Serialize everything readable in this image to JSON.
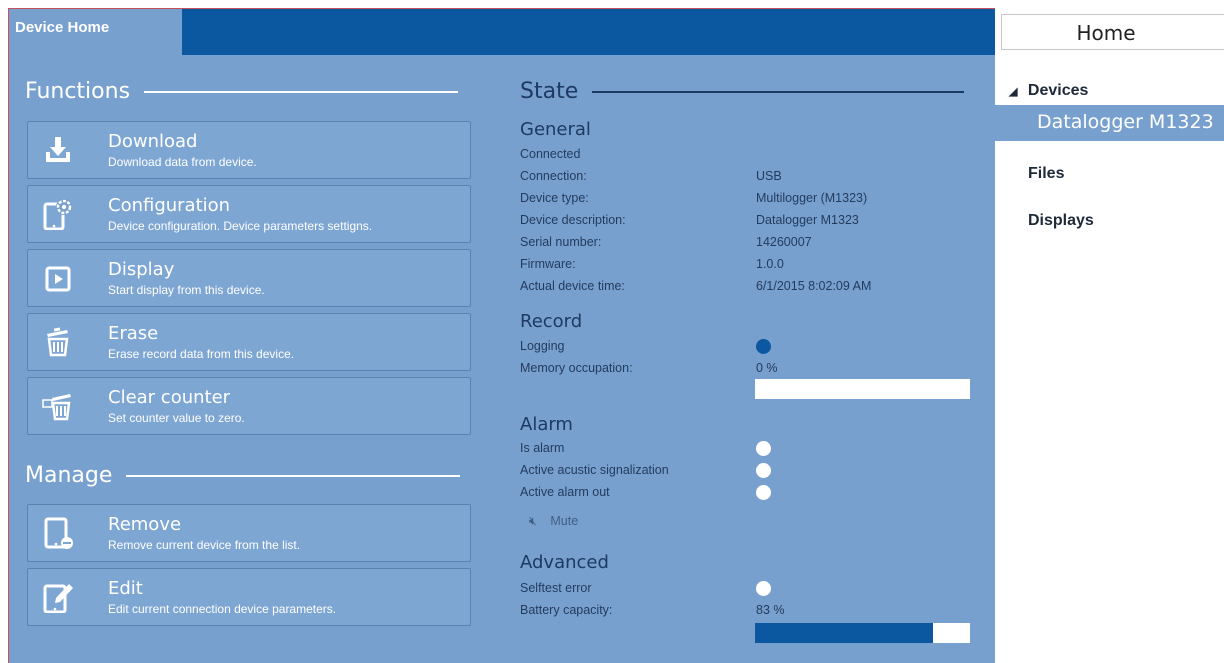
{
  "tab": {
    "label": "Device Home"
  },
  "functions": {
    "heading": "Functions",
    "items": [
      {
        "title": "Download",
        "desc": "Download data from device.",
        "icon": "download-icon"
      },
      {
        "title": "Configuration",
        "desc": "Device configuration. Device parameters settigns.",
        "icon": "configuration-icon"
      },
      {
        "title": "Display",
        "desc": "Start display from this device.",
        "icon": "display-icon"
      },
      {
        "title": "Erase",
        "desc": "Erase record data from this device.",
        "icon": "erase-icon"
      },
      {
        "title": "Clear counter",
        "desc": "Set counter value to zero.",
        "icon": "clear-counter-icon"
      }
    ]
  },
  "manage": {
    "heading": "Manage",
    "items": [
      {
        "title": "Remove",
        "desc": "Remove current device from the list.",
        "icon": "remove-device-icon"
      },
      {
        "title": "Edit",
        "desc": "Edit current connection device parameters.",
        "icon": "edit-icon"
      }
    ]
  },
  "state": {
    "heading": "State",
    "general": {
      "heading": "General",
      "connected": "Connected",
      "rows": [
        {
          "label": "Connection:",
          "value": "USB"
        },
        {
          "label": "Device type:",
          "value": "Multilogger (M1323)"
        },
        {
          "label": "Device description:",
          "value": "Datalogger M1323"
        },
        {
          "label": "Serial number:",
          "value": "14260007"
        },
        {
          "label": "Firmware:",
          "value": "1.0.0"
        },
        {
          "label": "Actual device time:",
          "value": "6/1/2015 8:02:09 AM"
        }
      ]
    },
    "record": {
      "heading": "Record",
      "logging_label": "Logging",
      "logging_on": true,
      "memory_label": "Memory occupation:",
      "memory_value": "0 %",
      "memory_fraction": 0.0
    },
    "alarm": {
      "heading": "Alarm",
      "rows": [
        {
          "label": "Is alarm",
          "on": false
        },
        {
          "label": "Active acustic signalization",
          "on": false
        },
        {
          "label": "Active alarm out",
          "on": false
        }
      ],
      "mute_label": "Mute"
    },
    "advanced": {
      "heading": "Advanced",
      "selftest_label": "Selftest error",
      "selftest_on": false,
      "battery_label": "Battery capacity:",
      "battery_value": "83 %",
      "battery_fraction": 0.83
    }
  },
  "sidebar": {
    "home_label": "Home",
    "devices_label": "Devices",
    "selected_device": "Datalogger M1323",
    "files_label": "Files",
    "displays_label": "Displays"
  },
  "colors": {
    "panel_bg": "#78a0ce",
    "accent": "#0b57a0",
    "dark_text": "#1d3a63"
  }
}
